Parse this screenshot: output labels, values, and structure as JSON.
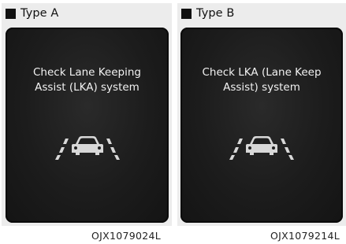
{
  "panels": [
    {
      "header": "Type A",
      "message_line1": "Check Lane Keeping",
      "message_line2": "Assist (LKA) system",
      "caption": "OJX1079024L"
    },
    {
      "header": "Type B",
      "message_line1": "Check LKA (Lane Keep",
      "message_line2": "Assist) system",
      "caption": "OJX1079214L"
    }
  ],
  "icon": "lane-keeping-assist-icon",
  "colors": {
    "screen_background": "#1c1c1c",
    "screen_text": "#f2f2f2",
    "icon_color": "#d8d8d8",
    "panel_background": "#ececec"
  }
}
